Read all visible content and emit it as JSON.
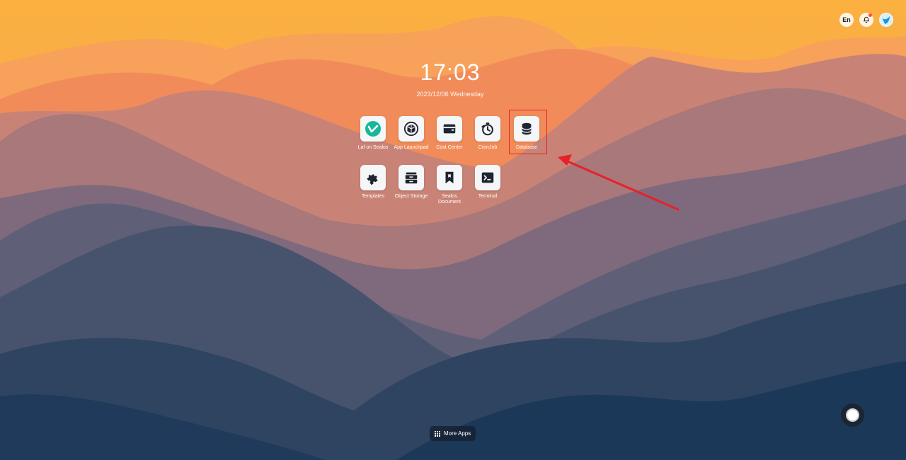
{
  "topbar": {
    "language": "En",
    "notification_icon": "bell-icon",
    "avatar_icon": "user-avatar-icon"
  },
  "clock": {
    "time": "17:03",
    "date": "2023/12/06 Wednesday"
  },
  "apps": [
    {
      "label": "Laf on Sealos",
      "icon": "laf-logo-icon"
    },
    {
      "label": "App Launchpad",
      "icon": "cube-icon"
    },
    {
      "label": "Cost Center",
      "icon": "wallet-icon"
    },
    {
      "label": "CronJob",
      "icon": "stopwatch-icon"
    },
    {
      "label": "Database",
      "icon": "database-icon"
    },
    {
      "label": "Templates",
      "icon": "puzzle-icon"
    },
    {
      "label": "Object Storage",
      "icon": "storage-box-icon"
    },
    {
      "label": "Sealos Document",
      "icon": "bookmark-icon"
    },
    {
      "label": "Terminal",
      "icon": "terminal-icon"
    }
  ],
  "more_apps": {
    "label": "More Apps",
    "icon": "grid-icon"
  },
  "colors": {
    "highlight": "#e8202a",
    "sky": "#f4a445",
    "laf_green": "#16b89a"
  }
}
